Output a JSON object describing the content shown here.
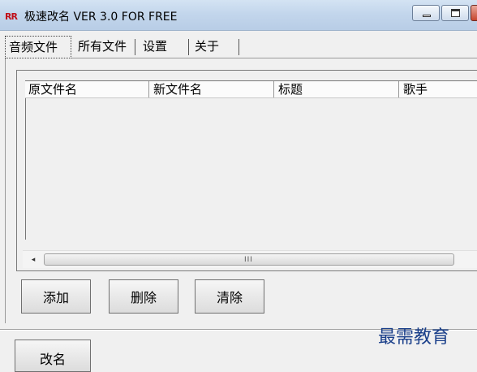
{
  "window": {
    "app_icon_text": "RR",
    "title": "极速改名 VER 3.0 FOR FREE"
  },
  "tabs": [
    {
      "label": "音频文件",
      "active": true
    },
    {
      "label": "所有文件",
      "active": false
    },
    {
      "label": "设置",
      "active": false
    },
    {
      "label": "关于",
      "active": false
    }
  ],
  "list": {
    "columns": [
      "原文件名",
      "新文件名",
      "标题",
      "歌手"
    ],
    "rows": []
  },
  "scrollbar": {
    "left_arrow": "◂",
    "grip": "III"
  },
  "buttons": {
    "add": "添加",
    "delete": "删除",
    "clear": "清除",
    "rename": "改名"
  },
  "watermark": "最需教育"
}
